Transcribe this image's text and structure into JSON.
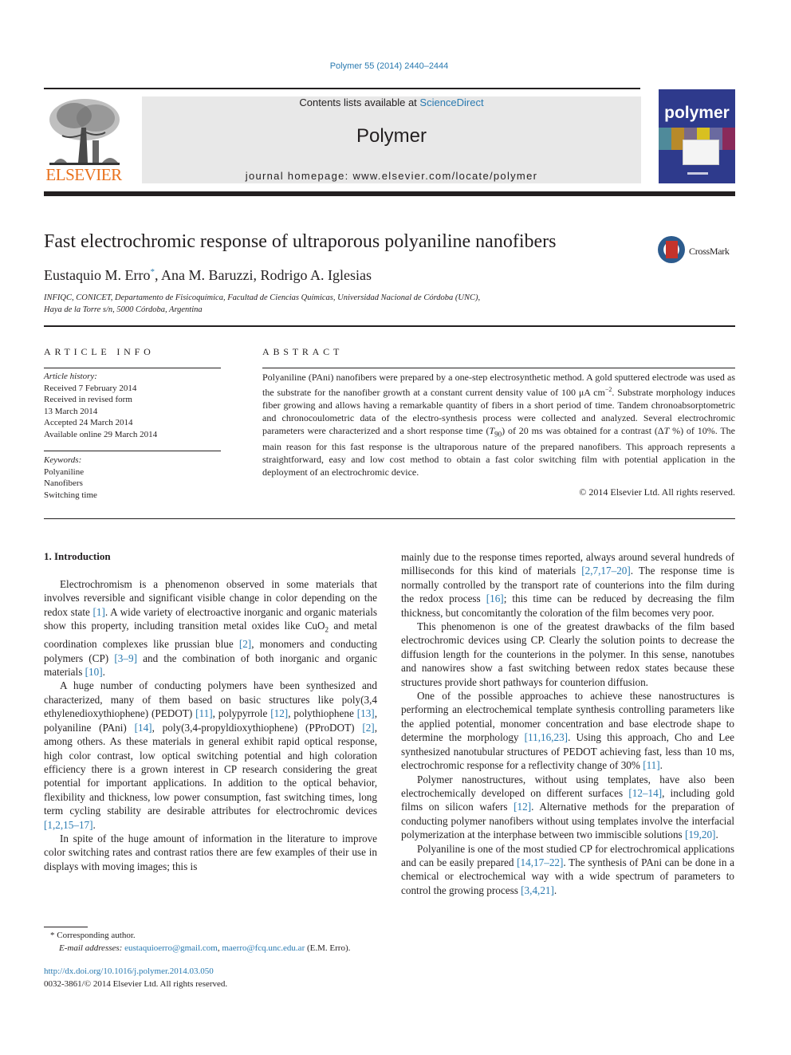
{
  "header": {
    "journal_ref": "Polymer 55 (2014) 2440–2444",
    "contents_prefix": "Contents lists available at ",
    "contents_link": "ScienceDirect",
    "journal_title": "Polymer",
    "homepage": "journal homepage: www.elsevier.com/locate/polymer",
    "publisher_logo_text": "ELSEVIER",
    "cover_title": "polymer",
    "crossmark_label": "CrossMark"
  },
  "article": {
    "title": "Fast electrochromic response of ultraporous polyaniline nanofibers",
    "authors": [
      {
        "name": "Eustaquio M. Erro",
        "corresponding": true
      },
      {
        "name": "Ana M. Baruzzi",
        "corresponding": false
      },
      {
        "name": "Rodrigo A. Iglesias",
        "corresponding": false
      }
    ],
    "author_sep": ", ",
    "corresponding_mark": "*",
    "affiliation_line1": "INFIQC, CONICET, Departamento de Fisicoquímica, Facultad de Ciencias Químicas, Universidad Nacional de Córdoba (UNC),",
    "affiliation_line2": "Haya de la Torre s/n, 5000 Córdoba, Argentina"
  },
  "article_info": {
    "heading": "ARTICLE INFO",
    "history_label": "Article history:",
    "history": [
      "Received 7 February 2014",
      "Received in revised form",
      "13 March 2014",
      "Accepted 24 March 2014",
      "Available online 29 March 2014"
    ],
    "keywords_label": "Keywords:",
    "keywords": [
      "Polyaniline",
      "Nanofibers",
      "Switching time"
    ]
  },
  "abstract": {
    "heading": "ABSTRACT",
    "text_1": "Polyaniline (PAni) nanofibers were prepared by a one-step electrosynthetic method. A gold sputtered electrode was used as the substrate for the nanofiber growth at a constant current density value of 100 μA cm",
    "sup_1": "−2",
    "text_2": ". Substrate morphology induces fiber growing and allows having a remarkable quantity of fibers in a short period of time. Tandem chronoabsorptometric and chronocoulometric data of the electro-synthesis process were collected and analyzed. Several electrochromic parameters were characterized and a short response time (",
    "t90_var": "T",
    "t90_sub": "90",
    "text_3": ") of 20 ms was obtained for a contrast (Δ",
    "delta_var": "T",
    "text_4": " %) of 10%. The main reason for this fast response is the ultraporous nature of the prepared nanofibers. This approach represents a straightforward, easy and low cost method to obtain a fast color switching film with potential application in the deployment of an electrochromic device.",
    "copyright": "© 2014 Elsevier Ltd. All rights reserved."
  },
  "intro": {
    "heading": "1.  Introduction",
    "p1": {
      "a": "Electrochromism is a phenomenon observed in some materials that involves reversible and significant visible change in color depending on the redox state ",
      "r1": "[1]",
      "b": ". A wide variety of electroactive inorganic and organic materials show this property, including transition metal oxides like CuO",
      "sub": "2",
      "c": " and metal coordination complexes like prussian blue ",
      "r2": "[2]",
      "d": ", monomers and conducting polymers (CP) ",
      "r3": "[3–9]",
      "e": " and the combination of both inorganic and organic materials ",
      "r4": "[10]",
      "f": "."
    },
    "p2": {
      "a": "A huge number of conducting polymers have been synthesized and characterized, many of them based on basic structures like poly(3,4 ethylenedioxythiophene) (PEDOT) ",
      "r1": "[11]",
      "b": ", polypyrrole ",
      "r2": "[12]",
      "c": ", polythiophene ",
      "r3": "[13]",
      "d": ", polyaniline (PAni) ",
      "r4": "[14]",
      "e": ", poly(3,4-propyldioxythiophene) (PProDOT) ",
      "r5": "[2]",
      "f": ", among others. As these materials in general exhibit rapid optical response, high color contrast, low optical switching potential and high coloration efficiency there is a grown interest in CP research considering the great potential for important applications. In addition to the optical behavior, flexibility and thickness, low power consumption, fast switching times, long term cycling stability are desirable attributes for electrochromic devices ",
      "r6": "[1,2,15–17]",
      "g": "."
    },
    "p3": {
      "a": "In spite of the huge amount of information in the literature to improve color switching rates and contrast ratios there are few examples of their use in displays with moving images; this is mainly due to the response times reported, always around several hundreds of milliseconds for this kind of materials ",
      "r1": "[2,7,17–20]",
      "b": ". The response time is normally controlled by the transport rate of counterions into the film during the redox process ",
      "r2": "[16]",
      "c": "; this time can be reduced by decreasing the film thickness, but concomitantly the coloration of the film becomes very poor."
    },
    "p4": "This phenomenon is one of the greatest drawbacks of the film based electrochromic devices using CP. Clearly the solution points to decrease the diffusion length for the counterions in the polymer. In this sense, nanotubes and nanowires show a fast switching between redox states because these structures provide short pathways for counterion diffusion.",
    "p5": {
      "a": "One of the possible approaches to achieve these nanostructures is performing an electrochemical template synthesis controlling parameters like the applied potential, monomer concentration and base electrode shape to determine the morphology ",
      "r1": "[11,16,23]",
      "b": ". Using this approach, Cho and Lee synthesized nanotubular structures of PEDOT achieving fast, less than 10 ms, electrochromic response for a reflectivity change of 30% ",
      "r2": "[11]",
      "c": "."
    },
    "p6": {
      "a": "Polymer nanostructures, without using templates, have also been electrochemically developed on different surfaces ",
      "r1": "[12–14]",
      "b": ", including gold films on silicon wafers ",
      "r2": "[12]",
      "c": ". Alternative methods for the preparation of conducting polymer nanofibers without using templates involve the interfacial polymerization at the interphase between two immiscible solutions ",
      "r3": "[19,20]",
      "d": "."
    },
    "p7": {
      "a": "Polyaniline is one of the most studied CP for electrochromical applications and can be easily prepared ",
      "r1": "[14,17–22]",
      "b": ". The synthesis of PAni can be done in a chemical or electrochemical way with a wide spectrum of parameters to control the growing process ",
      "r2": "[3,4,21]",
      "c": "."
    }
  },
  "footnote": {
    "mark": "*",
    "corresponding": "Corresponding author.",
    "email_label": "E-mail addresses:",
    "email_1": "eustaquioerro@gmail.com",
    "email_sep": ", ",
    "email_2": "maerro@fcq.unc.edu.ar",
    "email_suffix": " (E.M. Erro)."
  },
  "doi": {
    "url": "http://dx.doi.org/10.1016/j.polymer.2014.03.050",
    "issn_line": "0032-3861/© 2014 Elsevier Ltd. All rights reserved."
  },
  "colors": {
    "link": "#2a7ab0",
    "elsevier_orange": "#e9711c",
    "banner_gray": "#e8e8e8",
    "cover_blue": "#2e3a8c"
  }
}
